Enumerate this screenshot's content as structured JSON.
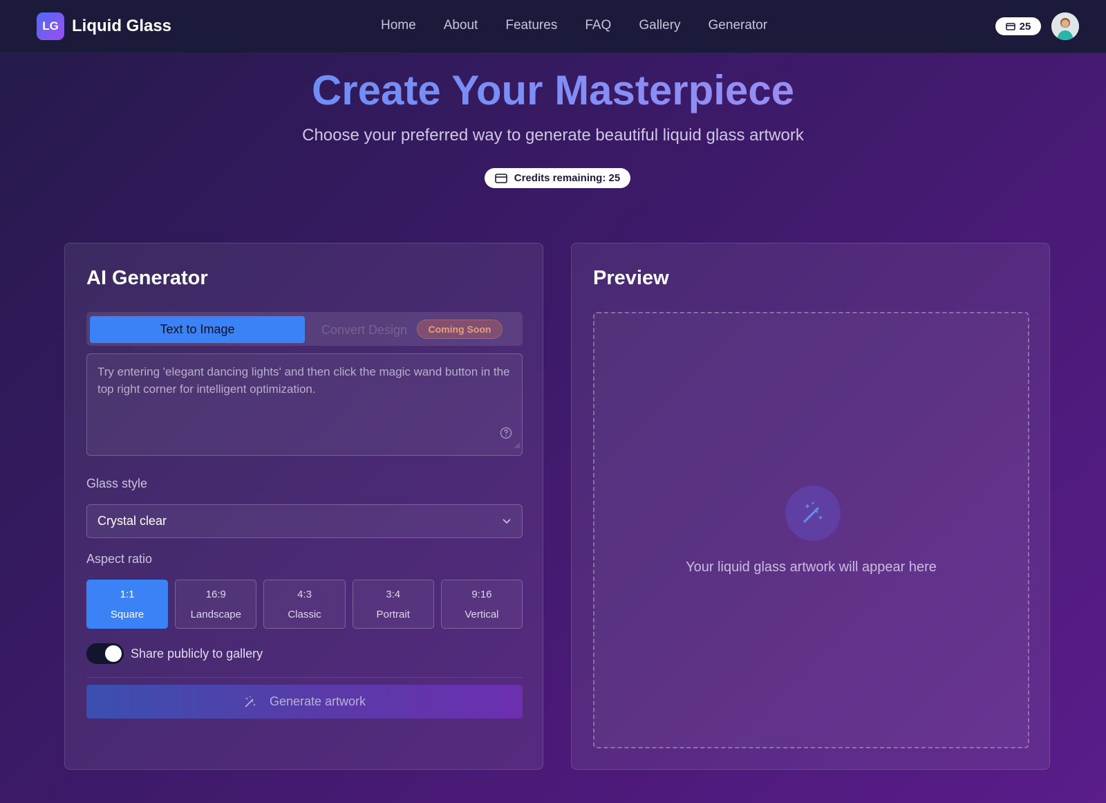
{
  "nav": {
    "logo_text": "LG",
    "brand": "Liquid Glass",
    "links": [
      "Home",
      "About",
      "Features",
      "FAQ",
      "Gallery",
      "Generator"
    ],
    "credits": "25"
  },
  "hero": {
    "title": "Create Your Masterpiece",
    "subtitle": "Choose your preferred way to generate beautiful liquid glass artwork",
    "credits_text": "Credits remaining: 25"
  },
  "generator": {
    "title": "AI Generator",
    "tab_active": "Text to Image",
    "tab_disabled": "Convert Design",
    "coming_soon": "Coming Soon",
    "prompt_placeholder": "Try entering 'elegant dancing lights' and then click the magic wand button in the top right corner for intelligent optimization.",
    "glass_style_label": "Glass style",
    "glass_style_value": "Crystal clear",
    "aspect_label": "Aspect ratio",
    "ratios": [
      {
        "ratio": "1:1",
        "name": "Square"
      },
      {
        "ratio": "16:9",
        "name": "Landscape"
      },
      {
        "ratio": "4:3",
        "name": "Classic"
      },
      {
        "ratio": "3:4",
        "name": "Portrait"
      },
      {
        "ratio": "9:16",
        "name": "Vertical"
      }
    ],
    "selected_ratio": "1:1",
    "share_label": "Share publicly to gallery",
    "share_enabled": true,
    "generate_label": "Generate artwork"
  },
  "preview": {
    "title": "Preview",
    "placeholder": "Your liquid glass artwork will appear here"
  },
  "colors": {
    "accent": "#3b82f6",
    "nav_bg": "#1c1a3a",
    "badge": "#e5a07a"
  }
}
